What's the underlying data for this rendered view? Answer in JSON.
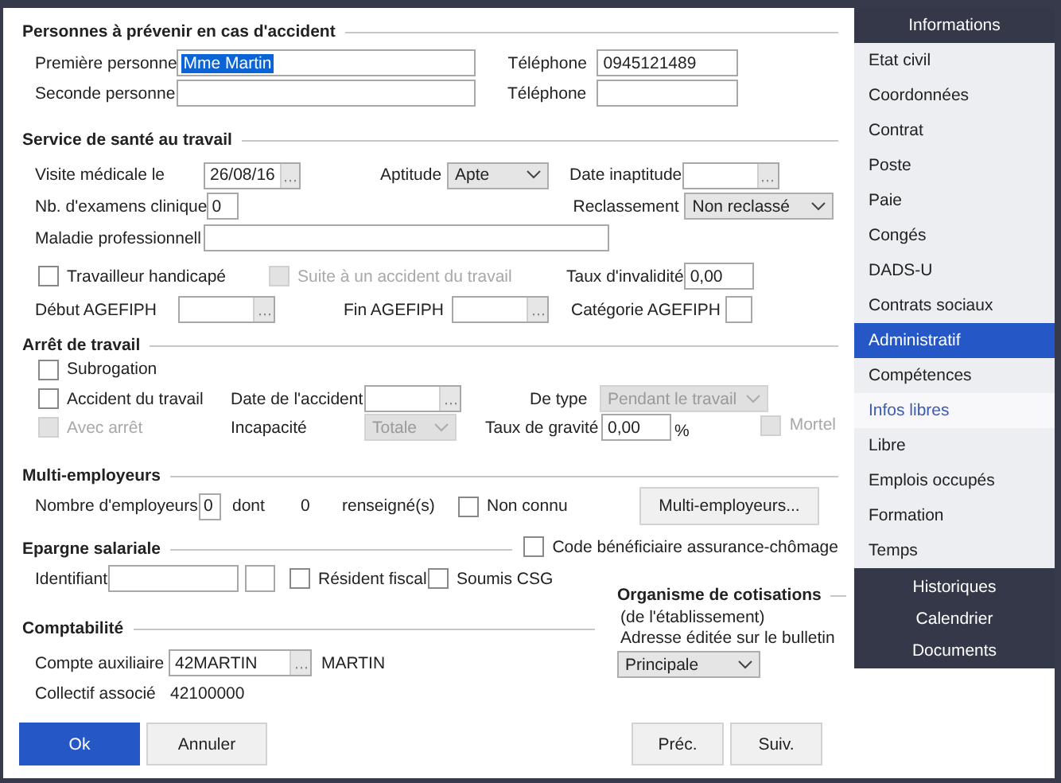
{
  "contacts": {
    "title": "Personnes à prévenir en cas d'accident",
    "rows": [
      {
        "label": "Première personne",
        "value": "Mme Martin",
        "value_selected": true,
        "phone_label": "Téléphone",
        "phone": "0945121489"
      },
      {
        "label": "Seconde personne",
        "phone_label": "Téléphone"
      }
    ]
  },
  "health": {
    "title": "Service de santé au travail",
    "visit": {
      "label": "Visite médicale le",
      "value": "26/08/16"
    },
    "aptitude": {
      "label": "Aptitude",
      "value": "Apte",
      "disabled": false
    },
    "inaptitude_date": {
      "label": "Date inaptitude"
    },
    "exams": {
      "label": "Nb. d'examens clinique",
      "value": "0"
    },
    "reclassement": {
      "label": "Reclassement",
      "value": "Non reclassé",
      "disabled": false
    },
    "disease": {
      "label": "Maladie professionnell"
    },
    "handicap": {
      "label": "Travailleur handicapé",
      "checked": false,
      "disabled": false
    },
    "after_accident": {
      "label": "Suite à un accident du travail",
      "checked": false,
      "disabled": true
    },
    "invalidity": {
      "label": "Taux d'invalidité",
      "value": "0,00"
    },
    "agefiph_start": {
      "label": "Début AGEFIPH"
    },
    "agefiph_end": {
      "label": "Fin AGEFIPH"
    },
    "agefiph_category": {
      "label": "Catégorie AGEFIPH"
    }
  },
  "work_stop": {
    "title": "Arrêt de travail",
    "subrogation": {
      "label": "Subrogation",
      "checked": false,
      "disabled": false
    },
    "work_accident": {
      "label": "Accident du travail",
      "checked": false,
      "disabled": false
    },
    "with_stop": {
      "label": "Avec arrêt",
      "checked": false,
      "disabled": true
    },
    "accident_date": {
      "label": "Date de l'accident"
    },
    "type": {
      "label": "De type",
      "value": "Pendant le travail",
      "disabled": true
    },
    "incapacity": {
      "label": "Incapacité",
      "value": "Totale",
      "disabled": true
    },
    "severity": {
      "label": "Taux de gravité",
      "value": "0,00",
      "unit": "%"
    },
    "fatal": {
      "label": "Mortel",
      "checked": false,
      "disabled": true
    }
  },
  "multi": {
    "title": "Multi-employeurs",
    "count_label": "Nombre d'employeurs",
    "count": "0",
    "of_label": "dont",
    "filled": "0",
    "filled_label": "renseigné(s)",
    "unknown": {
      "label": "Non connu",
      "checked": false,
      "disabled": false
    },
    "button": "Multi-employeurs..."
  },
  "savings": {
    "title": "Epargne salariale",
    "id_label": "Identifiant",
    "tax_resident": {
      "label": "Résident fiscal",
      "checked": false,
      "disabled": false
    },
    "csg": {
      "label": "Soumis CSG",
      "checked": false,
      "disabled": false
    },
    "beneficiary": {
      "label": "Code bénéficiaire assurance-chômage",
      "checked": false,
      "disabled": false
    }
  },
  "accounting": {
    "title": "Comptabilité",
    "account_label": "Compte auxiliaire",
    "account": "42MARTIN",
    "account_name": "MARTIN",
    "collective_label": "Collectif associé",
    "collective": "42100000"
  },
  "organism": {
    "title": "Organisme de cotisations",
    "subtitle": "(de l'établissement)",
    "address_label": "Adresse éditée sur le bulletin",
    "address": {
      "value": "Principale",
      "disabled": false
    }
  },
  "left_buttons": [
    {
      "label": "Ok",
      "kind": "primary"
    },
    {
      "label": "Annuler",
      "kind": "normal"
    }
  ],
  "right_buttons": [
    {
      "label": "Préc.",
      "kind": "normal"
    },
    {
      "label": "Suiv.",
      "kind": "normal"
    }
  ],
  "sidebar": {
    "header": "Informations",
    "items": [
      {
        "label": "Etat civil",
        "selected": false,
        "highlighted": false
      },
      {
        "label": "Coordonnées",
        "selected": false,
        "highlighted": false
      },
      {
        "label": "Contrat",
        "selected": false,
        "highlighted": false
      },
      {
        "label": "Poste",
        "selected": false,
        "highlighted": false
      },
      {
        "label": "Paie",
        "selected": false,
        "highlighted": false
      },
      {
        "label": "Congés",
        "selected": false,
        "highlighted": false
      },
      {
        "label": "DADS-U",
        "selected": false,
        "highlighted": false
      },
      {
        "label": "Contrats sociaux",
        "selected": false,
        "highlighted": false
      },
      {
        "label": "Administratif",
        "selected": true,
        "highlighted": false
      },
      {
        "label": "Compétences",
        "selected": false,
        "highlighted": false
      },
      {
        "label": "Infos libres",
        "selected": false,
        "highlighted": true
      },
      {
        "label": "Libre",
        "selected": false,
        "highlighted": false
      },
      {
        "label": "Emplois occupés",
        "selected": false,
        "highlighted": false
      },
      {
        "label": "Formation",
        "selected": false,
        "highlighted": false
      },
      {
        "label": "Temps",
        "selected": false,
        "highlighted": false
      }
    ],
    "footer": [
      "Historiques",
      "Calendrier",
      "Documents"
    ]
  }
}
